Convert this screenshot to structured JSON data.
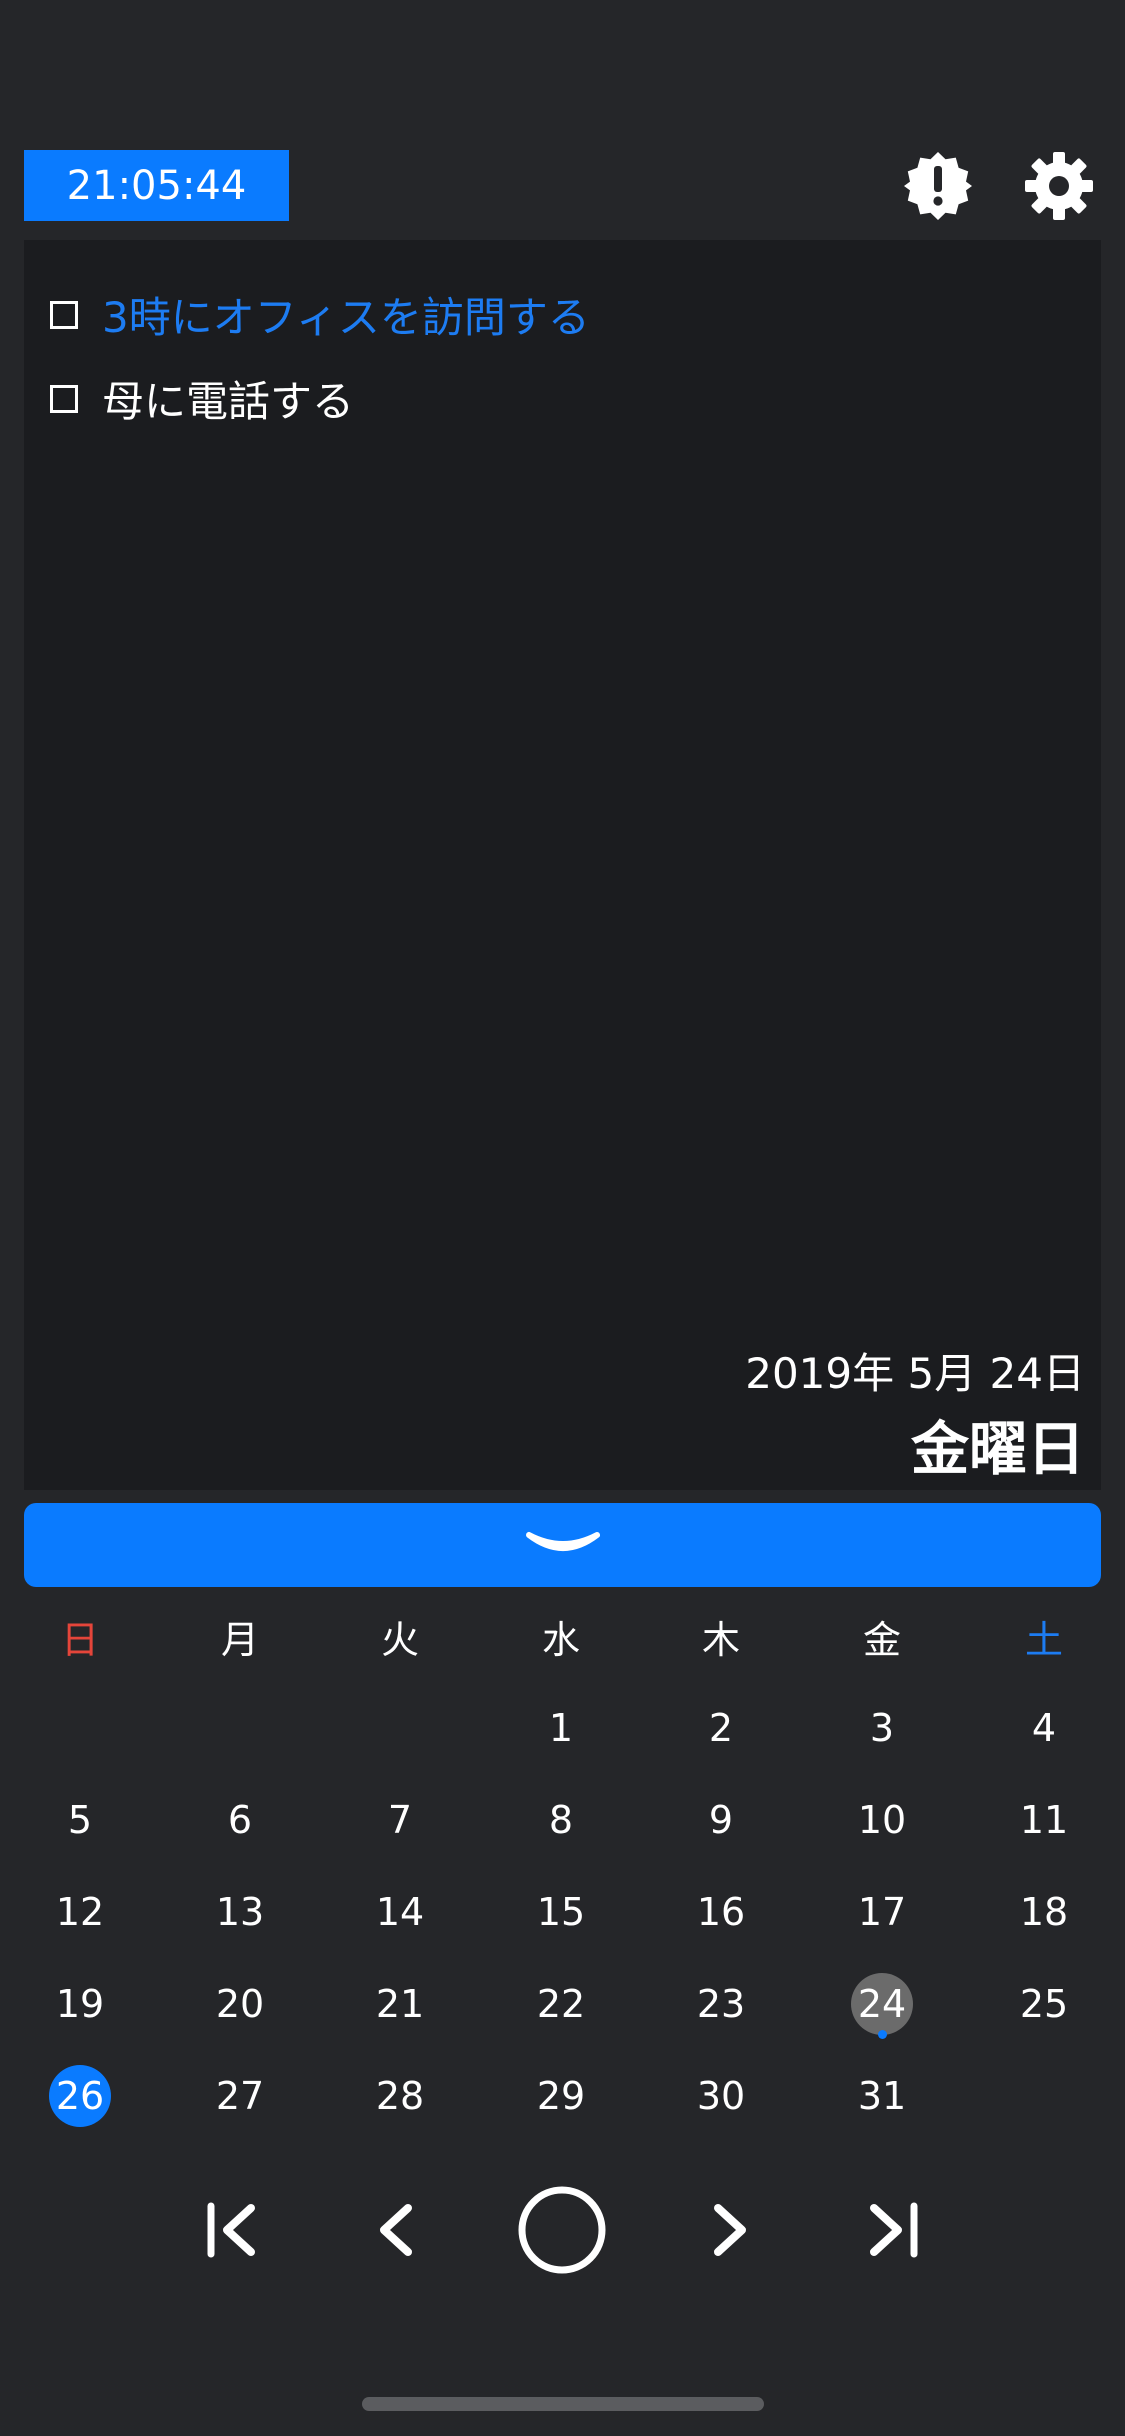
{
  "header": {
    "clock": "21:05:44",
    "alert_icon": "alert-badge-icon",
    "settings_icon": "gear-icon"
  },
  "memo": {
    "todos": [
      {
        "text": "3時にオフィスを訪問する",
        "checked": false,
        "color": "#1d7cf2"
      },
      {
        "text": "母に電話する",
        "checked": false,
        "color": "#ffffff"
      }
    ],
    "date": "2019年 5月 24日",
    "weekday": "金曜日"
  },
  "collapse_icon": "chevron-down-icon",
  "calendar": {
    "weekdays": [
      "日",
      "月",
      "火",
      "水",
      "木",
      "金",
      "土"
    ],
    "weeks": [
      [
        "",
        "",
        "",
        "1",
        "2",
        "3",
        "4"
      ],
      [
        "5",
        "6",
        "7",
        "8",
        "9",
        "10",
        "11"
      ],
      [
        "12",
        "13",
        "14",
        "15",
        "16",
        "17",
        "18"
      ],
      [
        "19",
        "20",
        "21",
        "22",
        "23",
        "24",
        "25"
      ],
      [
        "26",
        "27",
        "28",
        "29",
        "30",
        "31",
        ""
      ]
    ],
    "selected_day": "24",
    "today": "26",
    "event_days": [
      "24"
    ]
  },
  "nav": {
    "first_icon": "skip-to-first-icon",
    "prev_icon": "chevron-left-icon",
    "home_icon": "circle-today-icon",
    "next_icon": "chevron-right-icon",
    "last_icon": "skip-to-last-icon"
  },
  "colors": {
    "accent": "#0a7bff",
    "background": "#252629",
    "panel": "#1b1c1f",
    "sunday": "#e5453a",
    "saturday": "#1d7cf2",
    "selected_circle": "#6b6b6b"
  }
}
